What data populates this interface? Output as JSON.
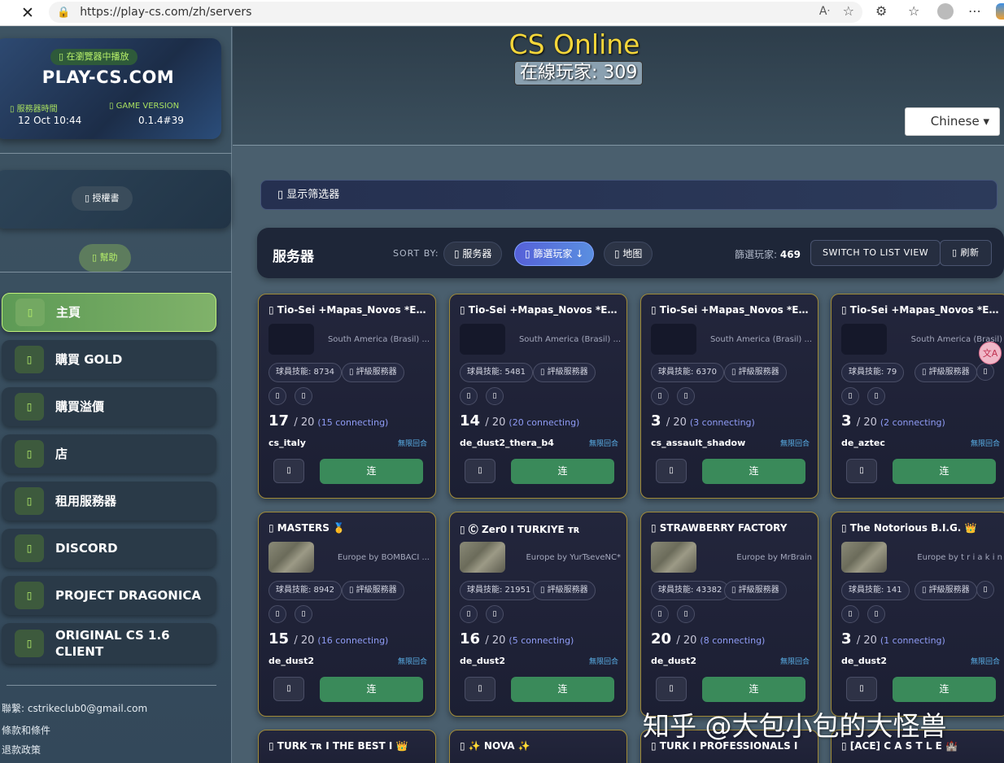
{
  "browser": {
    "url": "https://play-cs.com/zh/servers",
    "close_glyph": "✕"
  },
  "sidebar": {
    "badge": "▯ 在瀏覽器中播放",
    "site_name": "PLAY-CS.COM",
    "server_time_label": "▯ 服務器時間",
    "server_time_value": "12 Oct 10:44",
    "version_label": "▯ GAME VERSION",
    "version_value": "0.1.4#39",
    "license_button": "▯ 授權書",
    "help_button": "▯ 幫助",
    "nav": [
      {
        "label": "主頁",
        "icon": "▯",
        "active": true
      },
      {
        "label": "購買 GOLD",
        "icon": "▯"
      },
      {
        "label": "購買溢價",
        "icon": "▯"
      },
      {
        "label": "店",
        "icon": "▯"
      },
      {
        "label": "租用服務器",
        "icon": "▯"
      },
      {
        "label": "DISCORD",
        "icon": "▯"
      },
      {
        "label": "PROJECT DRAGONICA",
        "icon": "▯"
      },
      {
        "label": "ORIGINAL CS 1.6 CLIENT",
        "icon": "▯"
      }
    ],
    "contact": "聯繫: cstrikeclub0@gmail.com",
    "terms": "條款和條件",
    "refund": "退款政策"
  },
  "header": {
    "title": "CS Online",
    "online": "在線玩家: 309",
    "language": "Chinese ▾"
  },
  "filter_toggle": "▯  显示筛选器",
  "servers_bar": {
    "title": "服务器",
    "sort_label": "SORT BY:",
    "sort_server": "▯ 服务器",
    "sort_players": "▯ 篩選玩家 ↓",
    "sort_map": "▯ 地图",
    "filtered_label": "篩選玩家:",
    "filtered_count": "469",
    "switch_view": "SWITCH TO LIST VIEW",
    "refresh": "▯ 刷新"
  },
  "cards": [
    {
      "name": "▯ Tio-Sei +Mapas_Novos *Em_Br...",
      "loc": "South America (Brasil) ...",
      "skill": "球員技能: 8734",
      "rated": "▯ 評級服務器",
      "players": "17",
      "max": "/ 20",
      "connecting": "(15 connecting)",
      "map": "cs_italy",
      "mode": "無限回合",
      "fav": "▯",
      "connect": "连",
      "thumb": "dark"
    },
    {
      "name": "▯ Tio-Sei +Mapas_Novos *Em_Br...",
      "loc": "South America (Brasil) ...",
      "skill": "球員技能: 5481",
      "rated": "▯ 評級服務器",
      "players": "14",
      "max": "/ 20",
      "connecting": "(20 connecting)",
      "map": "de_dust2_thera_b4",
      "mode": "無限回合",
      "fav": "▯",
      "connect": "连",
      "thumb": "dark"
    },
    {
      "name": "▯ Tio-Sei +Mapas_Novos *Em_Br...",
      "loc": "South America (Brasil) ...",
      "skill": "球員技能: 6370",
      "rated": "▯ 評級服務器",
      "players": "3",
      "max": "/ 20",
      "connecting": "(3 connecting)",
      "map": "cs_assault_shadow",
      "mode": "無限回合",
      "fav": "▯",
      "connect": "连",
      "thumb": "dark"
    },
    {
      "name": "▯ Tio-Sei +Mapas_Novos *Em_Br...",
      "loc": "South America (Brasil)",
      "skill": "球員技能: 79",
      "rated": "▯ 評級服務器",
      "players": "3",
      "max": "/ 20",
      "connecting": "(2 connecting)",
      "map": "de_aztec",
      "mode": "無限回合",
      "fav": "▯",
      "connect": "连",
      "thumb": "dark"
    },
    {
      "name": "▯ MASTERS 🥇",
      "loc": "Europe by BOMBACI ...",
      "skill": "球員技能: 8942",
      "rated": "▯ 評級服務器",
      "players": "15",
      "max": "/ 20",
      "connecting": "(16 connecting)",
      "map": "de_dust2",
      "mode": "無限回合",
      "fav": "▯",
      "connect": "连",
      "thumb": "map"
    },
    {
      "name": "▯ Ⓒ Zer0 I TURKIYE ᴛʀ",
      "loc": "Europe by YurTseveNC*",
      "skill": "球員技能: 21951",
      "rated": "▯ 評級服務器",
      "players": "16",
      "max": "/ 20",
      "connecting": "(5 connecting)",
      "map": "de_dust2",
      "mode": "無限回合",
      "fav": "▯",
      "connect": "连",
      "thumb": "map"
    },
    {
      "name": "▯ STRAWBERRY FACTORY",
      "loc": "Europe by MrBrain",
      "skill": "球員技能: 43382",
      "rated": "▯ 評級服務器",
      "players": "20",
      "max": "/ 20",
      "connecting": "(8 connecting)",
      "map": "de_dust2",
      "mode": "無限回合",
      "fav": "▯",
      "connect": "连",
      "thumb": "map"
    },
    {
      "name": "▯ The Notorious B.I.G. 👑",
      "loc": "Europe by t r i a k i n",
      "skill": "球員技能: 141",
      "rated": "▯ 評級服務器",
      "players": "3",
      "max": "/ 20",
      "connecting": "(1 connecting)",
      "map": "de_dust2",
      "mode": "無限回合",
      "fav": "▯",
      "connect": "连",
      "thumb": "map"
    }
  ],
  "partial_cards": [
    {
      "name": "▯ TURK ᴛʀ I THE BEST I 👑"
    },
    {
      "name": "▯ ✨ NOVA ✨"
    },
    {
      "name": "▯ TURK I PROFESSIONALS I"
    },
    {
      "name": "▯ [ACE] C A S T L E 🏰"
    }
  ],
  "mini_glyph": "▯",
  "translate_badge": "文A",
  "watermark": "知乎 @大包小包的大怪兽"
}
